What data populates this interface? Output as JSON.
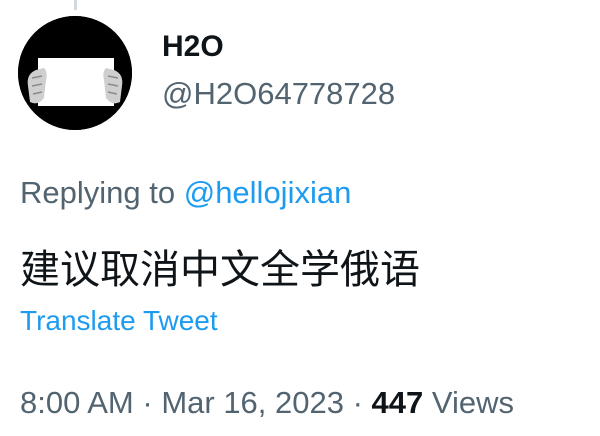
{
  "author": {
    "display_name": "H2O",
    "handle": "@H2O64778728"
  },
  "reply": {
    "prefix": "Replying to ",
    "mention": "@hellojixian"
  },
  "tweet": {
    "text": "建议取消中文全学俄语",
    "translate_label": "Translate Tweet"
  },
  "meta": {
    "time": "8:00 AM",
    "separator1": " · ",
    "date": "Mar 16, 2023",
    "separator2": " · ",
    "views_count": "447",
    "views_label": " Views"
  },
  "colors": {
    "accent": "#1d9bf0",
    "secondary_text": "#536471",
    "primary_text": "#0f1419"
  }
}
